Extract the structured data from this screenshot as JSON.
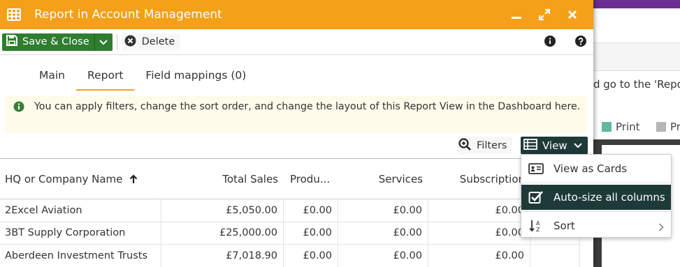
{
  "dialog": {
    "title": "Report in Account Management",
    "title_actions": [
      "minimize-icon",
      "expand-icon",
      "close-icon"
    ]
  },
  "toolbar": {
    "save_label": "Save & Close",
    "delete_label": "Delete"
  },
  "tabs": [
    {
      "label": "Main",
      "active": false
    },
    {
      "label": "Report",
      "active": true
    },
    {
      "label": "Field mappings (0)",
      "active": false
    }
  ],
  "notice": {
    "text": "You can apply filters, change the sort order, and change the layout of this Report View in the Dashboard here."
  },
  "filterbar": {
    "filters_label": "Filters",
    "view_label": "View"
  },
  "grid": {
    "columns": [
      "HQ or Company Name",
      "Total Sales",
      "Produ...",
      "Services",
      "Subscription"
    ],
    "rows": [
      [
        "2Excel Aviation",
        "£5,050.00",
        "£0.00",
        "£0.00",
        "£0.00"
      ],
      [
        "3BT Supply Corporation",
        "£25,000.00",
        "£0.00",
        "£0.00",
        "£0.00"
      ],
      [
        "Aberdeen Investment Trusts",
        "£7,018.90",
        "£0.00",
        "£0.00",
        "£0.00"
      ]
    ]
  },
  "view_menu": {
    "items": [
      {
        "label": "View as Cards",
        "icon": "id-card-icon",
        "active": false
      },
      {
        "label": "Auto-size all columns",
        "icon": "checkbox-checked-icon",
        "active": true
      },
      {
        "label": "Sort",
        "icon": "sort-alpha-icon",
        "active": false,
        "submenu": true
      }
    ]
  },
  "background": {
    "text": "d go to the 'Repo",
    "legend": [
      {
        "label": "Print",
        "color": "#5fb9a0"
      },
      {
        "label": "Pr",
        "color": "#b5b5b5"
      }
    ]
  },
  "colors": {
    "titlebar": "#f4a019",
    "save_button": "#2f7d2f",
    "view_button": "#1e3a38",
    "notice_bg": "#fffbea",
    "bg_topbar": "#6a2d91"
  }
}
